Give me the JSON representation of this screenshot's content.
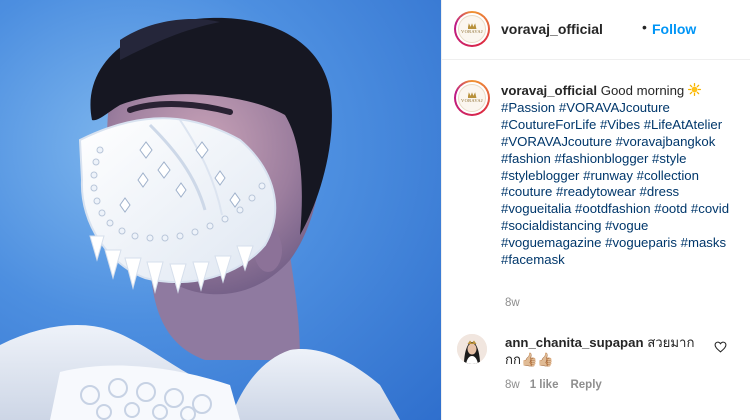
{
  "post": {
    "username": "voravaj_official",
    "follow_label": "Follow",
    "separator": "•",
    "avatar_brand": "VORAVAJ"
  },
  "caption": {
    "username": "voravaj_official",
    "text": "Good morning",
    "emoji": "sun-emoji",
    "hashtags": "#Passion #VORAVAJcouture #CoutureForLife #Vibes #LifeAtAtelier #VORAVAJcouture #voravajbangkok #fashion #fashionblogger #style #styleblogger #runway #collection #couture #readytowear #dress #vogueitalia #ootdfashion #ootd #covid #socialdistancing #vogue #voguemagazine #vogueparis #masks #facemask",
    "time": "8w"
  },
  "comment": {
    "username": "ann_chanita_supapan",
    "text": "สวยมาก กก👍🏼👍🏼",
    "time": "8w",
    "likes": "1 like",
    "reply_label": "Reply",
    "heart_icon": "heart-outline-icon"
  },
  "colors": {
    "link": "#00376b",
    "follow": "#0095f6",
    "muted": "#8e8e8e",
    "photo_background": "#4d8fe0"
  }
}
